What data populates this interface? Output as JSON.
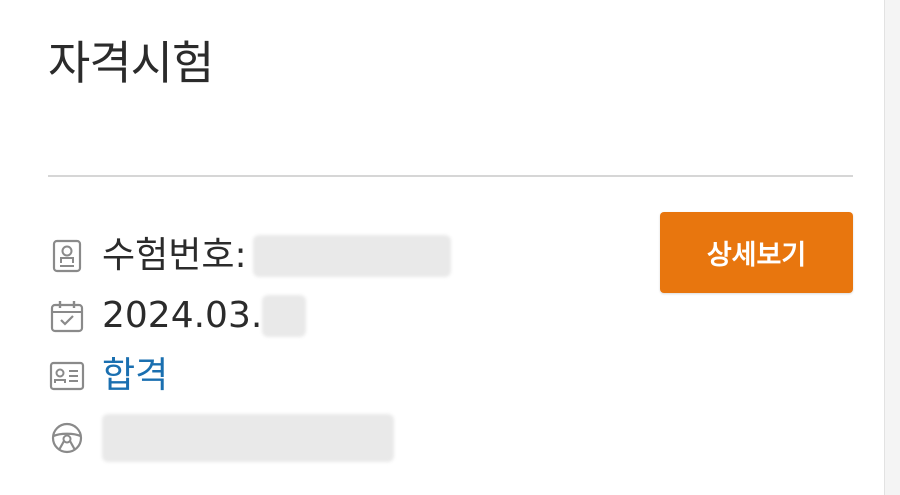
{
  "section": {
    "title": "자격시험"
  },
  "exam": {
    "number_label": "수험번호:",
    "date_prefix": "2024.03.",
    "result": "합격"
  },
  "actions": {
    "detail_button_label": "상세보기"
  },
  "colors": {
    "accent_button": "#e8760e",
    "status_pass": "#1a6fb0",
    "text": "#2b2b2b",
    "icon": "#8a8a8a"
  },
  "icons": {
    "exam_number": "id-badge-icon",
    "date": "calendar-check-icon",
    "result": "id-card-icon",
    "location": "steering-wheel-icon"
  }
}
